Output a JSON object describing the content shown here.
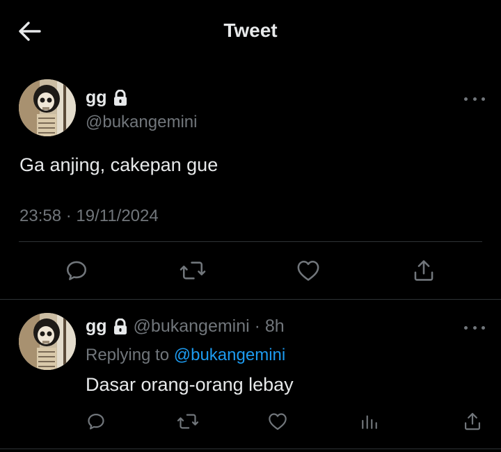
{
  "header": {
    "back_icon": "arrow-left-icon",
    "title": "Tweet"
  },
  "tweet": {
    "author_name": "gg",
    "author_handle": "@bukangemini",
    "protected_icon": "lock-icon",
    "text": "Ga anjing, cakepan gue",
    "meta": "23:58 · 19/11/2024",
    "actions": [
      "reply-icon",
      "retweet-icon",
      "like-icon",
      "share-icon"
    ]
  },
  "reply": {
    "author_name": "gg",
    "sub": "@bukangemini · 8h",
    "replying_prefix": "Replying to",
    "replying_to": "@bukangemini",
    "text": "Dasar orang-orang lebay",
    "actions": [
      "reply-icon",
      "retweet-icon",
      "like-icon",
      "analytics-icon",
      "share-icon"
    ]
  },
  "colors": {
    "background": "#000000",
    "text": "#e7e9ea",
    "muted": "#71767b",
    "link": "#1d9bf0",
    "divider": "#2f3336"
  }
}
